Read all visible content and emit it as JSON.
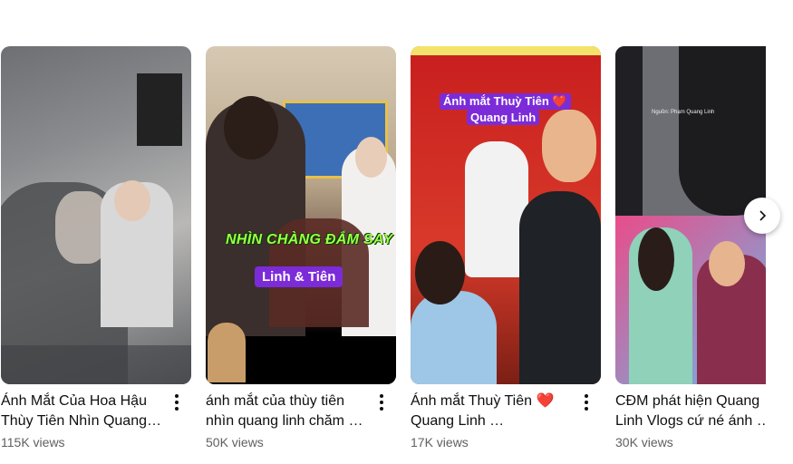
{
  "shorts": [
    {
      "title": "Ánh Mắt Của Hoa Hậu Thùy Tiên Nhìn Quang …",
      "views": "115K views"
    },
    {
      "title": "ánh mắt của thùy tiên nhìn quang linh chăm …",
      "views": "50K views",
      "caption_green": "NHÌN CHÀNG ĐẮM SAY",
      "caption_purple": "Linh & Tiên"
    },
    {
      "title_text": "Ánh mắt Thuỳ Tiên",
      "title_line2": "Quang Linh …",
      "views": "17K views",
      "overlay_line1": "Ánh mắt Thuỳ Tiên ❤️",
      "overlay_line2": "Quang Linh"
    },
    {
      "title": "CĐM phát hiện Quang Linh Vlogs cứ né ánh …",
      "views": "30K views",
      "source_text": "Nguồn: Phạm Quang Linh"
    }
  ],
  "colors": {
    "text_primary": "#0f0f0f",
    "text_secondary": "#606060",
    "accent_purple": "#7c2bd9"
  },
  "icons": {
    "more": "three-dots-vertical-icon",
    "next": "chevron-right-icon",
    "heart": "red-heart-emoji"
  }
}
